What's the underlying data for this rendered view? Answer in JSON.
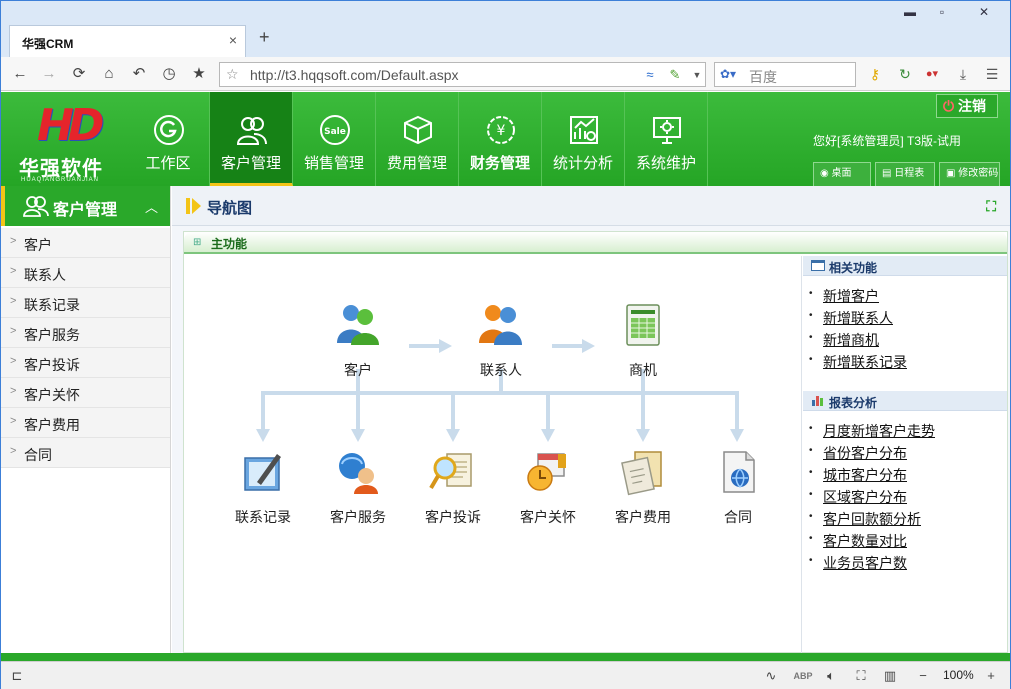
{
  "browser": {
    "tab_title": "华强CRM",
    "tab_close": "×",
    "new_tab": "+",
    "url": "http://t3.hqqsoft.com/Default.aspx",
    "search_placeholder": "百度",
    "zoom": "100%",
    "window_controls": {
      "minimize": "▬",
      "restore": "▫",
      "close": "✕"
    }
  },
  "app": {
    "logo_text": "华强软件",
    "logo_pinyin": "HUAQIANGRUANJIAN",
    "logo_mark": "HD",
    "main_nav": [
      {
        "label": "工作区",
        "icon": "g-icon"
      },
      {
        "label": "客户管理",
        "icon": "users-icon",
        "active": true
      },
      {
        "label": "销售管理",
        "icon": "sale-icon"
      },
      {
        "label": "费用管理",
        "icon": "box-icon"
      },
      {
        "label": "财务管理",
        "icon": "yen-icon",
        "bold": true
      },
      {
        "label": "统计分析",
        "icon": "chart-icon"
      },
      {
        "label": "系统维护",
        "icon": "monitor-icon"
      }
    ],
    "logout_label": "注销",
    "welcome_text": "您好[系统管理员] T3版-试用",
    "header_buttons": [
      {
        "label": "桌面",
        "icon": "desktop-icon"
      },
      {
        "label": "日程表",
        "icon": "calendar-icon"
      },
      {
        "label": "修改密码",
        "icon": "lock-icon"
      }
    ]
  },
  "sidebar": {
    "title": "客户管理",
    "collapse_glyph": "︿",
    "items": [
      "客户",
      "联系人",
      "联系记录",
      "客户服务",
      "客户投诉",
      "客户关怀",
      "客户费用",
      "合同"
    ]
  },
  "content": {
    "breadcrumb_title": "导航图",
    "panel_title": "主功能",
    "top_nodes": [
      "客户",
      "联系人",
      "商机"
    ],
    "bottom_nodes": [
      "联系记录",
      "客户服务",
      "客户投诉",
      "客户关怀",
      "客户费用",
      "合同"
    ],
    "related": {
      "title": "相关功能",
      "links": [
        "新增客户",
        "新增联系人",
        "新增商机",
        "新增联系记录"
      ]
    },
    "reports": {
      "title": "报表分析",
      "links": [
        "月度新增客户走势",
        "省份客户分布",
        "城市客户分布",
        "区域客户分布",
        "客户回款额分析",
        "客户数量对比",
        "业务员客户数"
      ]
    }
  },
  "colors": {
    "brand_green": "#2aa82a",
    "active_green": "#168216",
    "accent_yellow": "#f3c417",
    "arrow_blue": "#c9dbeb"
  }
}
